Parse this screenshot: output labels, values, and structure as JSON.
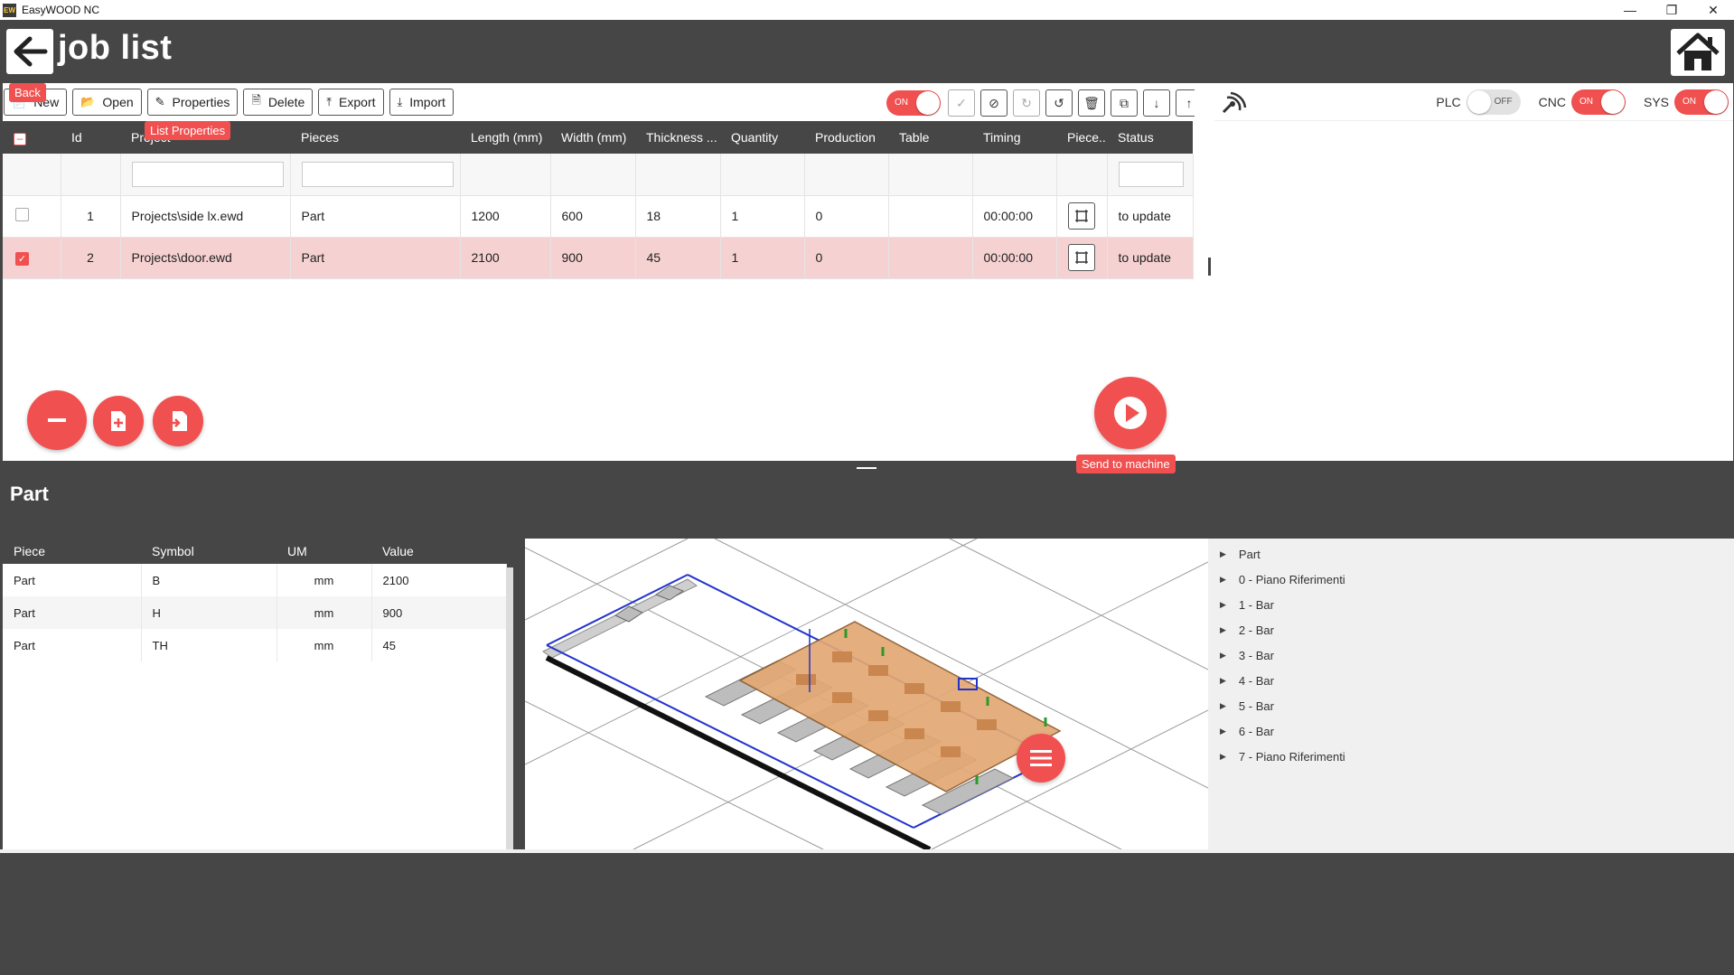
{
  "window": {
    "title": "EasyWOOD NC",
    "icon_text": "EW"
  },
  "header": {
    "title": "job list",
    "back_tooltip": "Back"
  },
  "toolbar": {
    "new_label": "New",
    "open_label": "Open",
    "properties_label": "Properties",
    "properties_tooltip": "List Properties",
    "delete_label": "Delete",
    "export_label": "Export",
    "import_label": "Import",
    "toggle_on_label": "ON"
  },
  "job_table": {
    "columns": [
      "Id",
      "Project",
      "Pieces",
      "Length (mm)",
      "Width (mm)",
      "Thickness ...",
      "Quantity",
      "Production",
      "Table",
      "Timing",
      "Piece...",
      "Status"
    ],
    "rows": [
      {
        "id": "1",
        "project": "Projects\\side lx.ewd",
        "pieces": "Part",
        "length": "1200",
        "width": "600",
        "thickness": "18",
        "quantity": "1",
        "production": "0",
        "table": "",
        "timing": "00:00:00",
        "status": "to update",
        "selected": false
      },
      {
        "id": "2",
        "project": "Projects\\door.ewd",
        "pieces": "Part",
        "length": "2100",
        "width": "900",
        "thickness": "45",
        "quantity": "1",
        "production": "0",
        "table": "",
        "timing": "00:00:00",
        "status": "to update",
        "selected": true
      }
    ]
  },
  "send": {
    "tooltip": "Send to machine"
  },
  "status_toggles": {
    "plc": {
      "label": "PLC",
      "state": "OFF"
    },
    "cnc": {
      "label": "CNC",
      "state": "ON"
    },
    "sys": {
      "label": "SYS",
      "state": "ON"
    }
  },
  "part": {
    "title": "Part",
    "columns": [
      "Piece",
      "Symbol",
      "UM",
      "Value"
    ],
    "rows": [
      {
        "piece": "Part",
        "symbol": "B",
        "um": "mm",
        "value": "2100"
      },
      {
        "piece": "Part",
        "symbol": "H",
        "um": "mm",
        "value": "900"
      },
      {
        "piece": "Part",
        "symbol": "TH",
        "um": "mm",
        "value": "45"
      }
    ]
  },
  "tree": {
    "items": [
      "Part",
      "0 - Piano Riferimenti",
      "1 - Bar",
      "2 - Bar",
      "3 - Bar",
      "4 - Bar",
      "5 - Bar",
      "6 - Bar",
      "7 - Piano Riferimenti"
    ]
  },
  "colors": {
    "accent": "#f0504f",
    "header_bg": "#464646",
    "selected_row": "#f6d1d1"
  }
}
